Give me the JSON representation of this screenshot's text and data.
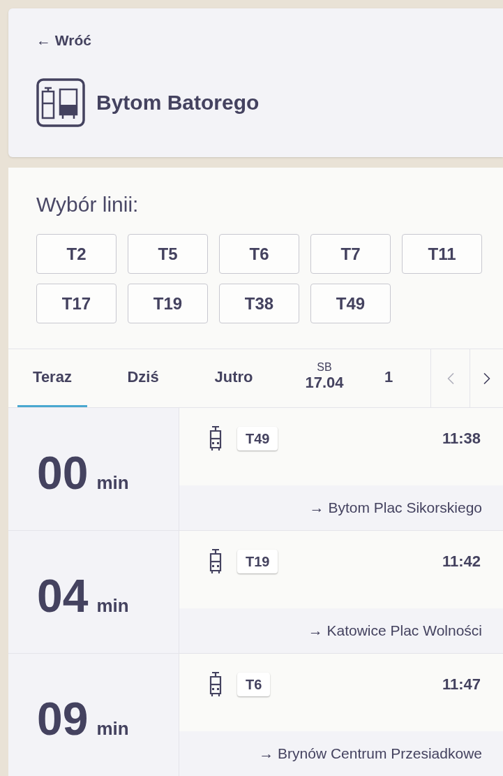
{
  "header": {
    "back": "← Wróć",
    "stop_name": "Bytom Batorego"
  },
  "line_picker": {
    "title": "Wybór linii:",
    "lines": [
      {
        "label": "T2",
        "selected": false
      },
      {
        "label": "T5",
        "selected": false
      },
      {
        "label": "T6",
        "selected": false
      },
      {
        "label": "T7",
        "selected": false
      },
      {
        "label": "T11",
        "selected": false
      },
      {
        "label": "T17",
        "selected": false
      },
      {
        "label": "T19",
        "selected": false
      },
      {
        "label": "T38",
        "selected": false
      },
      {
        "label": "T49",
        "selected": false
      }
    ]
  },
  "day_tabs": [
    {
      "label": "Teraz",
      "selected": true
    },
    {
      "label": "Dziś",
      "selected": false
    },
    {
      "label": "Jutro",
      "selected": false
    },
    {
      "weekday": "SB",
      "label": "17.04",
      "selected": false
    },
    {
      "label": "1",
      "selected": false
    }
  ],
  "departures": [
    {
      "minutes": "00",
      "unit": "min",
      "line": "T49",
      "time": "11:38",
      "destination": "→ Bytom Plac Sikorskiego"
    },
    {
      "minutes": "04",
      "unit": "min",
      "line": "T19",
      "time": "11:42",
      "destination": "→ Katowice Plac Wolności"
    },
    {
      "minutes": "09",
      "unit": "min",
      "line": "T6",
      "time": "11:47",
      "destination": "→ Brynów Centrum Przesiadkowe"
    }
  ]
}
